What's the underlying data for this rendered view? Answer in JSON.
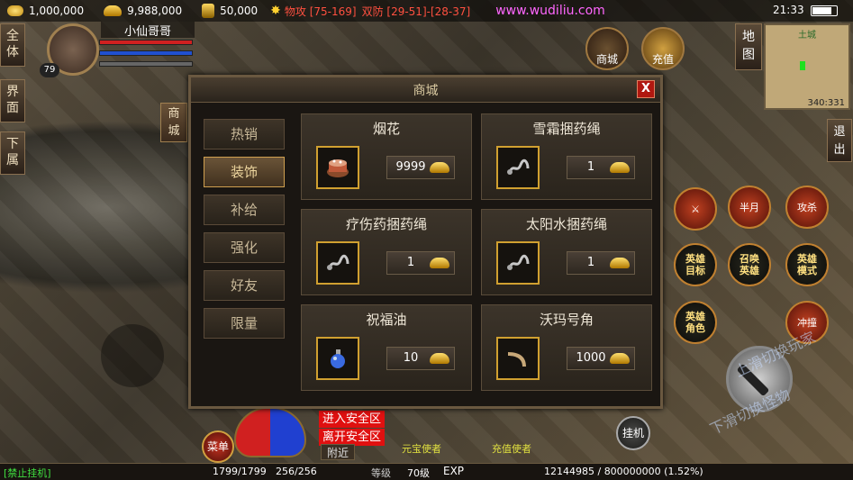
{
  "topbar": {
    "coins": "1,000,000",
    "gold": "9,988,000",
    "bind_gold": "50,000",
    "phys_attack": "物攻 [75-169]",
    "dual_defense": "双防 [29-51]-[28-37]",
    "watermark": "www.wudiliu.com",
    "clock": "21:33"
  },
  "player": {
    "name": "小仙哥哥",
    "level": "79"
  },
  "left_tabs": [
    "全体",
    "界面",
    "下属"
  ],
  "right_top": {
    "shop_label": "商城",
    "recharge_label": "充值",
    "map_label": "地图",
    "minimap_title": "土城",
    "minimap_coord": "340:331",
    "exit_label": "退出"
  },
  "skills": {
    "half_moon": "半月",
    "attack_kill": "攻杀",
    "hero_target": "英雄目标",
    "summon_hero": "召唤英雄",
    "hero_mode": "英雄模式",
    "hero_role": "英雄角色",
    "charge": "冲撞"
  },
  "hints": {
    "slide_up": "上滑切换玩家",
    "slide_down": "下滑切换怪物"
  },
  "bottom": {
    "menu_label": "菜单",
    "safe_enter": "进入安全区",
    "safe_leave": "离开安全区",
    "chat_tab": "附近",
    "npc1": "元宝使者",
    "npc2": "充值使者",
    "guaji_label": "挂机",
    "ban_guaji": "[禁止挂机]",
    "hp": "1799/1799",
    "mp": "256/256",
    "level_label": "等级",
    "level_value": "70级",
    "exp_label": "EXP",
    "exp_value": "12144985 / 800000000 (1.52%)"
  },
  "shop": {
    "title": "商城",
    "close": "X",
    "side_tab": "商城",
    "categories": [
      "热销",
      "装饰",
      "补给",
      "强化",
      "好友",
      "限量"
    ],
    "active_category": "装饰",
    "items": [
      {
        "name": "烟花",
        "price": "9999",
        "icon": "firework-cake-icon"
      },
      {
        "name": "雪霜捆药绳",
        "price": "1",
        "icon": "rope-icon"
      },
      {
        "name": "疗伤药捆药绳",
        "price": "1",
        "icon": "rope-icon"
      },
      {
        "name": "太阳水捆药绳",
        "price": "1",
        "icon": "rope-icon"
      },
      {
        "name": "祝福油",
        "price": "10",
        "icon": "potion-bottle-icon"
      },
      {
        "name": "沃玛号角",
        "price": "1000",
        "icon": "horn-icon"
      }
    ]
  },
  "colors": {
    "accent_gold": "#d0a030",
    "close_red": "#b01810",
    "safe_zone_red": "#e01010",
    "watermark_pink": "#ff66ff"
  }
}
